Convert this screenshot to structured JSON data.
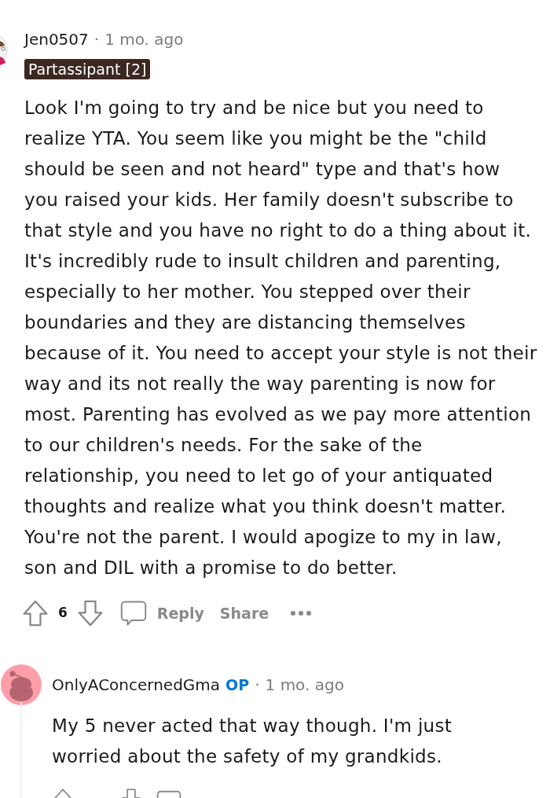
{
  "comments": [
    {
      "avatar": {
        "kind": "custom"
      },
      "author": "Jen0507",
      "separator": "·",
      "time": "1 mo. ago",
      "flair": "Partassipant [2]",
      "thread_line": false,
      "body": "Look I'm going to try and be nice but you need to realize YTA. You seem like you might be the \"child should be seen and not heard\" type and that's how you raised your kids. Her family doesn't subscribe to that style and you have no right to do a thing about it. It's incredibly rude to insult children and parenting, especially to her mother. You stepped over their boundaries and they are distancing themselves because of it. You need to accept your style is not their way and its not really the way parenting is now for most. Parenting has evolved as we pay more attention to our children's needs. For the sake of the relationship, you need to let go of your antiquated thoughts and realize what you think doesn't matter. You're not the parent. I would apogize to my in law, son and DIL with a promise to do better.",
      "actions": {
        "cut_off": false,
        "score": "6",
        "reply": "Reply",
        "share": "Share"
      }
    },
    {
      "avatar": {
        "kind": "default"
      },
      "author": "OnlyAConcernedGma",
      "author_tag": "OP",
      "separator": "·",
      "time": "1 mo. ago",
      "thread_line": true,
      "body": "My 5 never acted that way though. I'm just worried about the safety of my grandkids.",
      "actions": {
        "cut_off": true
      }
    }
  ]
}
